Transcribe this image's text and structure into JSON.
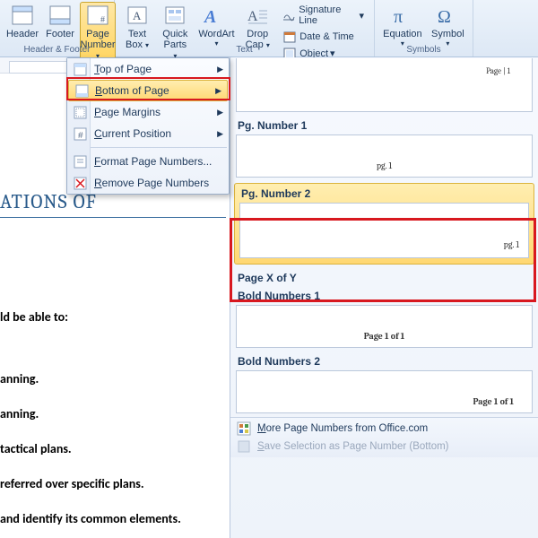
{
  "ribbon": {
    "header": {
      "label": "Header"
    },
    "footer": {
      "label": "Footer"
    },
    "pageNumber": {
      "label": "Page\nNumber"
    },
    "textBox": {
      "label": "Text\nBox"
    },
    "quickParts": {
      "label": "Quick\nParts"
    },
    "wordArt": {
      "label": "WordArt"
    },
    "dropCap": {
      "label": "Drop\nCap"
    },
    "signatureLine": "Signature Line",
    "dateTime": "Date & Time",
    "object": "Object",
    "equation": {
      "label": "Equation"
    },
    "symbol": {
      "label": "Symbol"
    },
    "groupHeaderFooter": "Header & Footer",
    "groupText": "Text",
    "groupSymbols": "Symbols"
  },
  "submenu": {
    "topOfPage": {
      "pre": "T",
      "rest": "op of Page"
    },
    "bottomOfPage": {
      "pre": "B",
      "rest": "ottom of Page"
    },
    "pageMargins": {
      "pre": "P",
      "rest": "age Margins"
    },
    "currentPosition": {
      "pre": "C",
      "rest": "urrent Position"
    },
    "formatPageNumbers": {
      "pre": "F",
      "rest": "ormat Page Numbers..."
    },
    "removePageNumbers": {
      "pre": "R",
      "rest": "emove Page Numbers"
    }
  },
  "gallery": {
    "pageTag": "Page | 1",
    "pgNumber1": {
      "title": "Pg. Number 1",
      "label": "pg. 1"
    },
    "pgNumber2": {
      "title": "Pg. Number 2",
      "label": "pg. 1"
    },
    "pageXofY": "Page X of Y",
    "bold1": {
      "title": "Bold Numbers 1",
      "label": "Page 1 of 1"
    },
    "bold2": {
      "title": "Bold Numbers 2",
      "label": "Page 1 of 1"
    },
    "more": {
      "pre": "M",
      "rest": "ore Page Numbers from Office.com"
    },
    "save": {
      "pre": "S",
      "rest": "ave Selection as Page Number (Bottom)"
    }
  },
  "doc": {
    "heading": "ATIONS OF",
    "line1": "ld be able to:",
    "line2": "anning.",
    "line3": "anning.",
    "line4": "tactical plans.",
    "line5": "referred over specific plans.",
    "line6": "and identify its common elements."
  }
}
